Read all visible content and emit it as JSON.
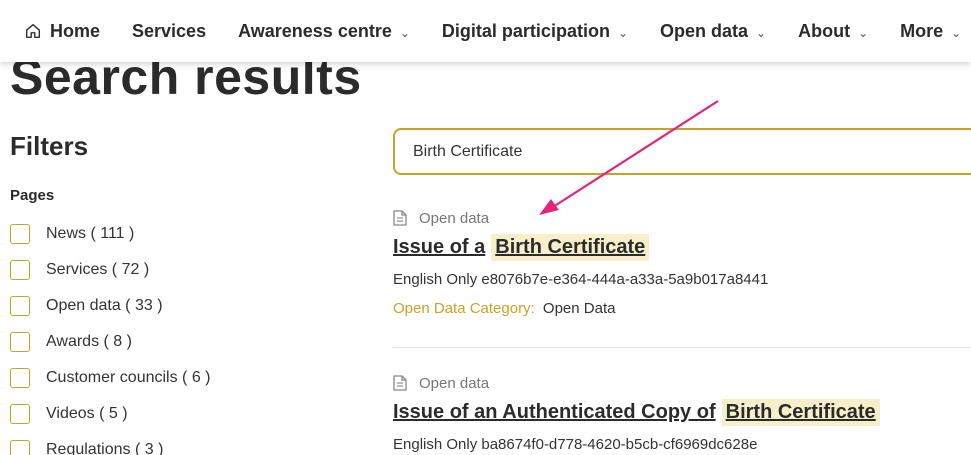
{
  "nav": {
    "items": [
      {
        "label": "Home",
        "icon": "home-icon"
      },
      {
        "label": "Services"
      },
      {
        "label": "Awareness centre",
        "dropdown": true
      },
      {
        "label": "Digital participation",
        "dropdown": true
      },
      {
        "label": "Open data",
        "dropdown": true
      },
      {
        "label": "About",
        "dropdown": true
      },
      {
        "label": "More",
        "dropdown": true
      }
    ]
  },
  "page": {
    "title": "Search results"
  },
  "filters": {
    "title": "Filters",
    "group": "Pages",
    "items": [
      {
        "label": "News ( 111 )"
      },
      {
        "label": "Services ( 72 )"
      },
      {
        "label": "Open data ( 33 )"
      },
      {
        "label": "Awards ( 8 )"
      },
      {
        "label": "Customer councils ( 6 )"
      },
      {
        "label": "Videos ( 5 )"
      },
      {
        "label": "Regulations ( 3 )"
      }
    ]
  },
  "search": {
    "value": "Birth Certificate"
  },
  "results": [
    {
      "type": "Open data",
      "title_prefix": "Issue of a",
      "title_highlight": "Birth Certificate",
      "subtitle": "English Only e8076b7e-e364-444a-a33a-5a9b017a8441",
      "category_key": "Open Data Category:",
      "category_value": "Open Data"
    },
    {
      "type": "Open data",
      "title_prefix": "Issue of an Authenticated Copy of",
      "title_highlight": "Birth Certificate",
      "subtitle": "English Only ba8674f0-d778-4620-b5cb-cf6969dc628e"
    }
  ],
  "colors": {
    "accent": "#c9a227",
    "highlight": "#f6efc9",
    "arrow": "#e0257a"
  }
}
